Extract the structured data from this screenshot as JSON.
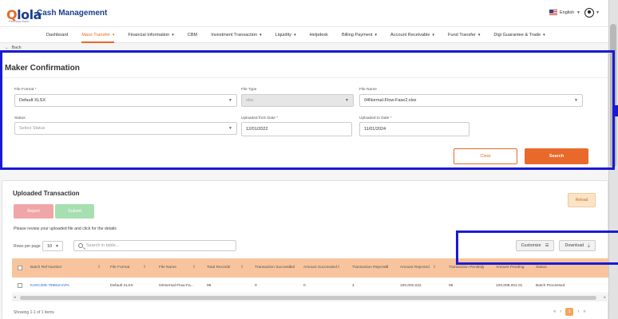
{
  "header": {
    "logo_text_a": "Q",
    "logo_text_b": "lola",
    "logo_sub": "Permata Bank",
    "title": "Cash Management",
    "language": "English"
  },
  "nav": [
    {
      "label": "Dashboard",
      "caret": false,
      "active": false
    },
    {
      "label": "Mass Transfer",
      "caret": true,
      "active": true
    },
    {
      "label": "Financial Information",
      "caret": true,
      "active": false
    },
    {
      "label": "CBM",
      "caret": false,
      "active": false
    },
    {
      "label": "Investment Transaction",
      "caret": true,
      "active": false
    },
    {
      "label": "Liquidity",
      "caret": true,
      "active": false
    },
    {
      "label": "Helpdesk",
      "caret": false,
      "active": false
    },
    {
      "label": "Billing Payment",
      "caret": true,
      "active": false
    },
    {
      "label": "Account Receivable",
      "caret": true,
      "active": false
    },
    {
      "label": "Fund Transfer",
      "caret": true,
      "active": false
    },
    {
      "label": "Digi Guarantee & Trade",
      "caret": true,
      "active": false
    }
  ],
  "back_label": "Back",
  "maker": {
    "title": "Maker Confirmation",
    "file_format": {
      "label": "File Format",
      "value": "Default XLSX"
    },
    "file_type": {
      "label": "File Type",
      "value": "xlsx"
    },
    "file_name": {
      "label": "File Name",
      "value": "04Normal-Flow-Fase2.xlsx"
    },
    "status": {
      "label": "Status",
      "placeholder": "Select Status"
    },
    "uploaded_from": {
      "label": "Uploaded from Date",
      "value": "12/01/2022"
    },
    "uploaded_to": {
      "label": "Uploaded to Date",
      "value": "11/01/2024"
    },
    "clear_label": "Clear",
    "search_label": "Search"
  },
  "uploaded": {
    "title": "Uploaded Transaction",
    "reject_label": "Reject",
    "submit_label": "Submit",
    "reload_label": "Reload",
    "hint": "Please review your uploaded file and click for the details",
    "rows_per_page_label": "Rows per page",
    "rows_per_page_value": "10",
    "search_placeholder": "Search in table...",
    "customize_label": "Customize",
    "download_label": "Download",
    "columns": [
      "Batch Ref Number",
      "File Format",
      "File Name",
      "Total Records",
      "Transaction Succeeded",
      "Amount Succeeded",
      "Transaction Rejected",
      "Amount Rejected",
      "Transaction Pending",
      "Amount Pending",
      "Status"
    ],
    "rows": [
      [
        "K2SC309-7998UHAPA",
        "Default XLSX",
        "04Normal-Flow-Fa...",
        "99",
        "0",
        "0",
        "4",
        "100,002,022",
        "95",
        "100,008,001.01",
        "Batch Processed"
      ]
    ],
    "showing": "Showing 1-1 of 1 items",
    "current_page": "1"
  },
  "colors": {
    "accent": "#e86a24",
    "brand": "#1a3f8b",
    "highlight": "#1a1ad4"
  }
}
